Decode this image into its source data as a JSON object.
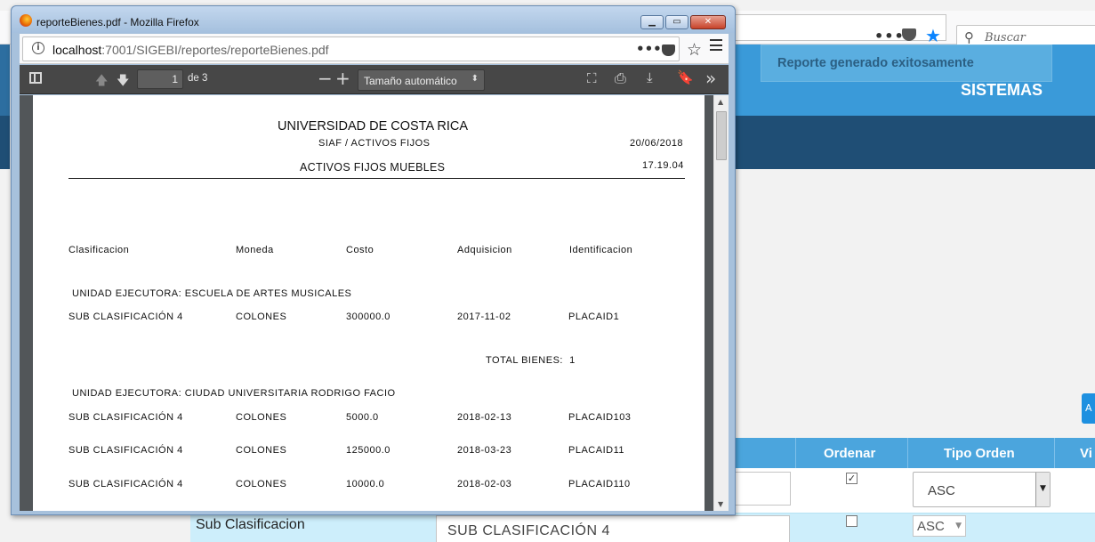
{
  "background": {
    "search_placeholder": "Buscar",
    "toast": "Reporte generado exitosamente",
    "header_brand": "SISTEMAS",
    "side_button_label": "A",
    "table": {
      "headers": [
        "Ordenar",
        "Tipo Orden",
        "Vi"
      ],
      "row1": {
        "ordenar_checked": true,
        "tipo_orden": "ASC"
      },
      "row2": {
        "label": "Sub Clasificacion",
        "value": "SUB CLASIFICACIÓN 4",
        "ordenar_checked": false,
        "tipo_orden": "ASC"
      }
    }
  },
  "popup": {
    "window_title": "reporteBienes.pdf - Mozilla Firefox",
    "url_host": "localhost",
    "url_rest": ":7001/SIGEBI/reportes/reporteBienes.pdf",
    "pdf_toolbar": {
      "page_number": "1",
      "page_of": "de 3",
      "zoom": "Tamaño automático"
    },
    "document": {
      "org": "UNIVERSIDAD DE COSTA RICA",
      "system": "SIAF / ACTIVOS FIJOS",
      "date": "20/06/2018",
      "title": "ACTIVOS FIJOS MUEBLES",
      "time": "17.19.04",
      "columns": [
        "Clasificacion",
        "Moneda",
        "Costo",
        "Adquisicion",
        "Identificacion"
      ],
      "groups": [
        {
          "heading": "UNIDAD EJECUTORA: ESCUELA DE ARTES MUSICALES",
          "rows": [
            [
              "SUB CLASIFICACIÓN 4",
              "COLONES",
              "300000.0",
              "2017-11-02",
              "PLACAID1"
            ]
          ],
          "total": "TOTAL BIENES:  1"
        },
        {
          "heading": "UNIDAD EJECUTORA: CIUDAD UNIVERSITARIA RODRIGO FACIO",
          "rows": [
            [
              "SUB CLASIFICACIÓN 4",
              "COLONES",
              "5000.0",
              "2018-02-13",
              "PLACAID103"
            ],
            [
              "SUB CLASIFICACIÓN 4",
              "COLONES",
              "125000.0",
              "2018-03-23",
              "PLACAID11"
            ],
            [
              "SUB CLASIFICACIÓN 4",
              "COLONES",
              "10000.0",
              "2018-02-03",
              "PLACAID110"
            ]
          ]
        }
      ]
    }
  }
}
